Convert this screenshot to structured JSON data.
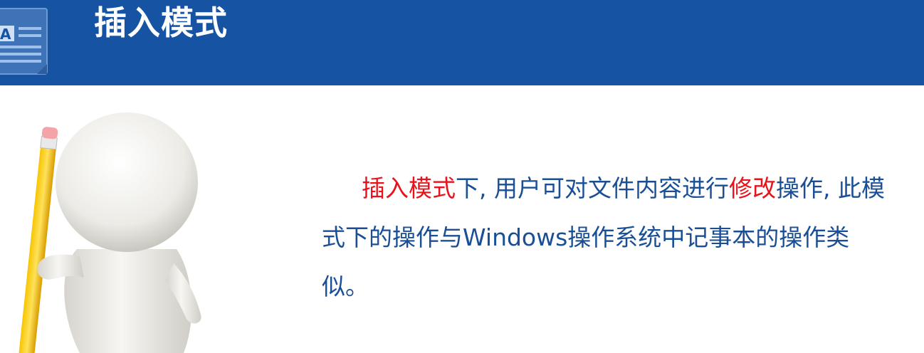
{
  "header": {
    "title": "插入模式",
    "icon": "document-text-icon"
  },
  "body": {
    "seg1": "插入模式",
    "seg2": "下, 用户可对文件内容进行",
    "seg3": "修改",
    "seg4": "操作, 此模式下的操作与Windows操作系统中记事本的操作类似。"
  },
  "colors": {
    "header_bg": "#1653a3",
    "text": "#1a4f96",
    "highlight": "#e8121a"
  }
}
